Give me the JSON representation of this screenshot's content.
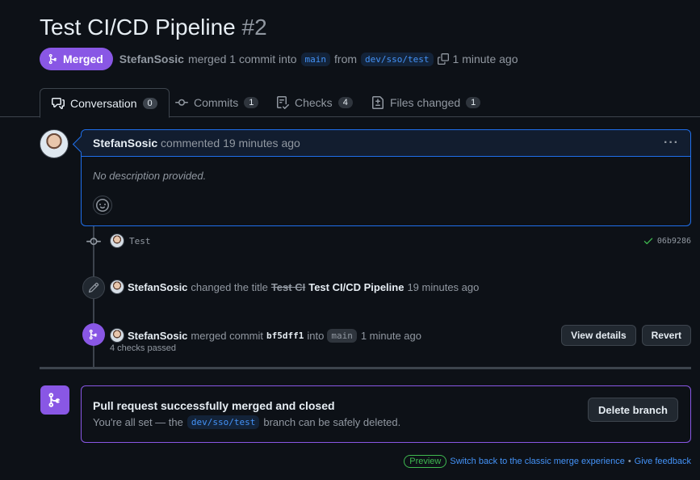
{
  "pr": {
    "title": "Test CI/CD Pipeline",
    "number": "#2",
    "state": "Merged",
    "author": "StefanSosic",
    "merged_text": "merged 1 commit into",
    "base_branch": "main",
    "from_text": "from",
    "head_branch": "dev/sso/test",
    "time": "1 minute ago"
  },
  "tabs": [
    {
      "label": "Conversation",
      "count": "0"
    },
    {
      "label": "Commits",
      "count": "1"
    },
    {
      "label": "Checks",
      "count": "4"
    },
    {
      "label": "Files changed",
      "count": "1"
    }
  ],
  "comment": {
    "author": "StefanSosic",
    "meta": "commented 19 minutes ago",
    "body": "No description provided.",
    "menu": "···"
  },
  "commit_event": {
    "message": "Test",
    "sha": "06b9286"
  },
  "rename_event": {
    "author": "StefanSosic",
    "action": "changed the title",
    "old_title": "Test CI",
    "new_title": "Test CI/CD Pipeline",
    "time": "19 minutes ago"
  },
  "merge_event": {
    "author": "StefanSosic",
    "action": "merged commit",
    "sha": "bf5dff1",
    "into_text": "into",
    "branch": "main",
    "time": "1 minute ago",
    "checks": "4 checks passed",
    "view_details_label": "View details",
    "revert_label": "Revert"
  },
  "merge_box": {
    "heading": "Pull request successfully merged and closed",
    "sub_prefix": "You're all set — the",
    "branch": "dev/sso/test",
    "sub_suffix": "branch can be safely deleted.",
    "delete_label": "Delete branch"
  },
  "footer": {
    "preview": "Preview",
    "switch_link": "Switch back to the classic merge experience",
    "sep": "•",
    "feedback_link": "Give feedback"
  },
  "colors": {
    "merged": "#8957e5",
    "link": "#4493f8",
    "success": "#3fb950"
  }
}
